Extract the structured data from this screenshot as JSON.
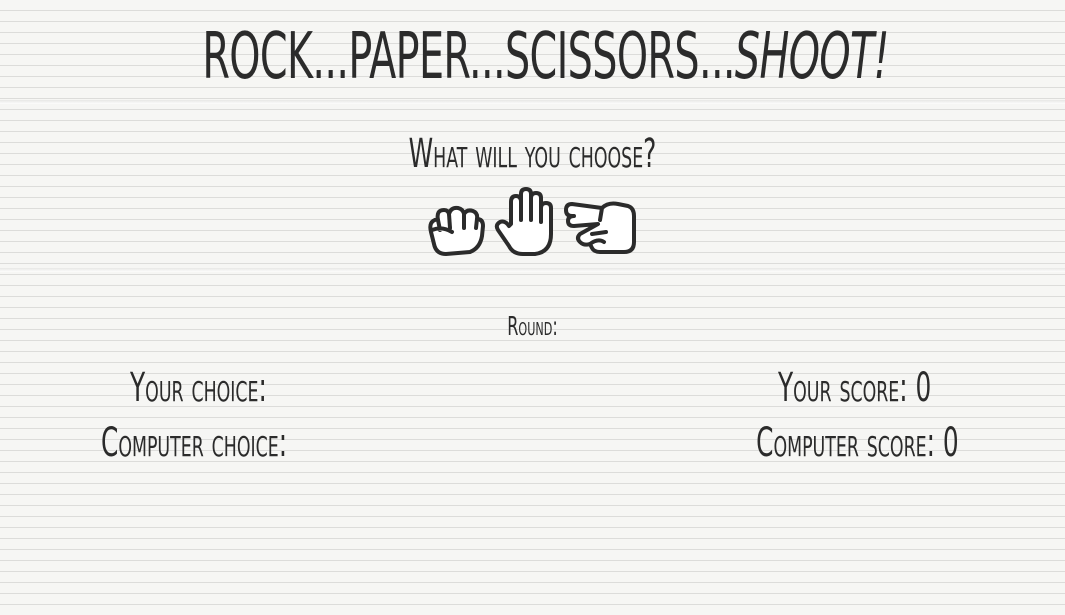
{
  "header": {
    "title_main": "ROCK...PAPER...SCISSORS...",
    "title_emphasis": "SHOOT!"
  },
  "prompt": {
    "text": "What will you choose?"
  },
  "choices": [
    {
      "name": "rock",
      "icon": "rock-fist-icon"
    },
    {
      "name": "paper",
      "icon": "paper-hand-icon"
    },
    {
      "name": "scissors",
      "icon": "scissors-hand-icon"
    }
  ],
  "game": {
    "round_label": "Round:",
    "round_value": "",
    "your_choice_label": "Your choice:",
    "your_choice_value": "",
    "computer_choice_label": "Computer choice:",
    "computer_choice_value": "",
    "your_score_label": "Your score:",
    "your_score_value": "0",
    "computer_score_label": "Computer score:",
    "computer_score_value": "0"
  }
}
